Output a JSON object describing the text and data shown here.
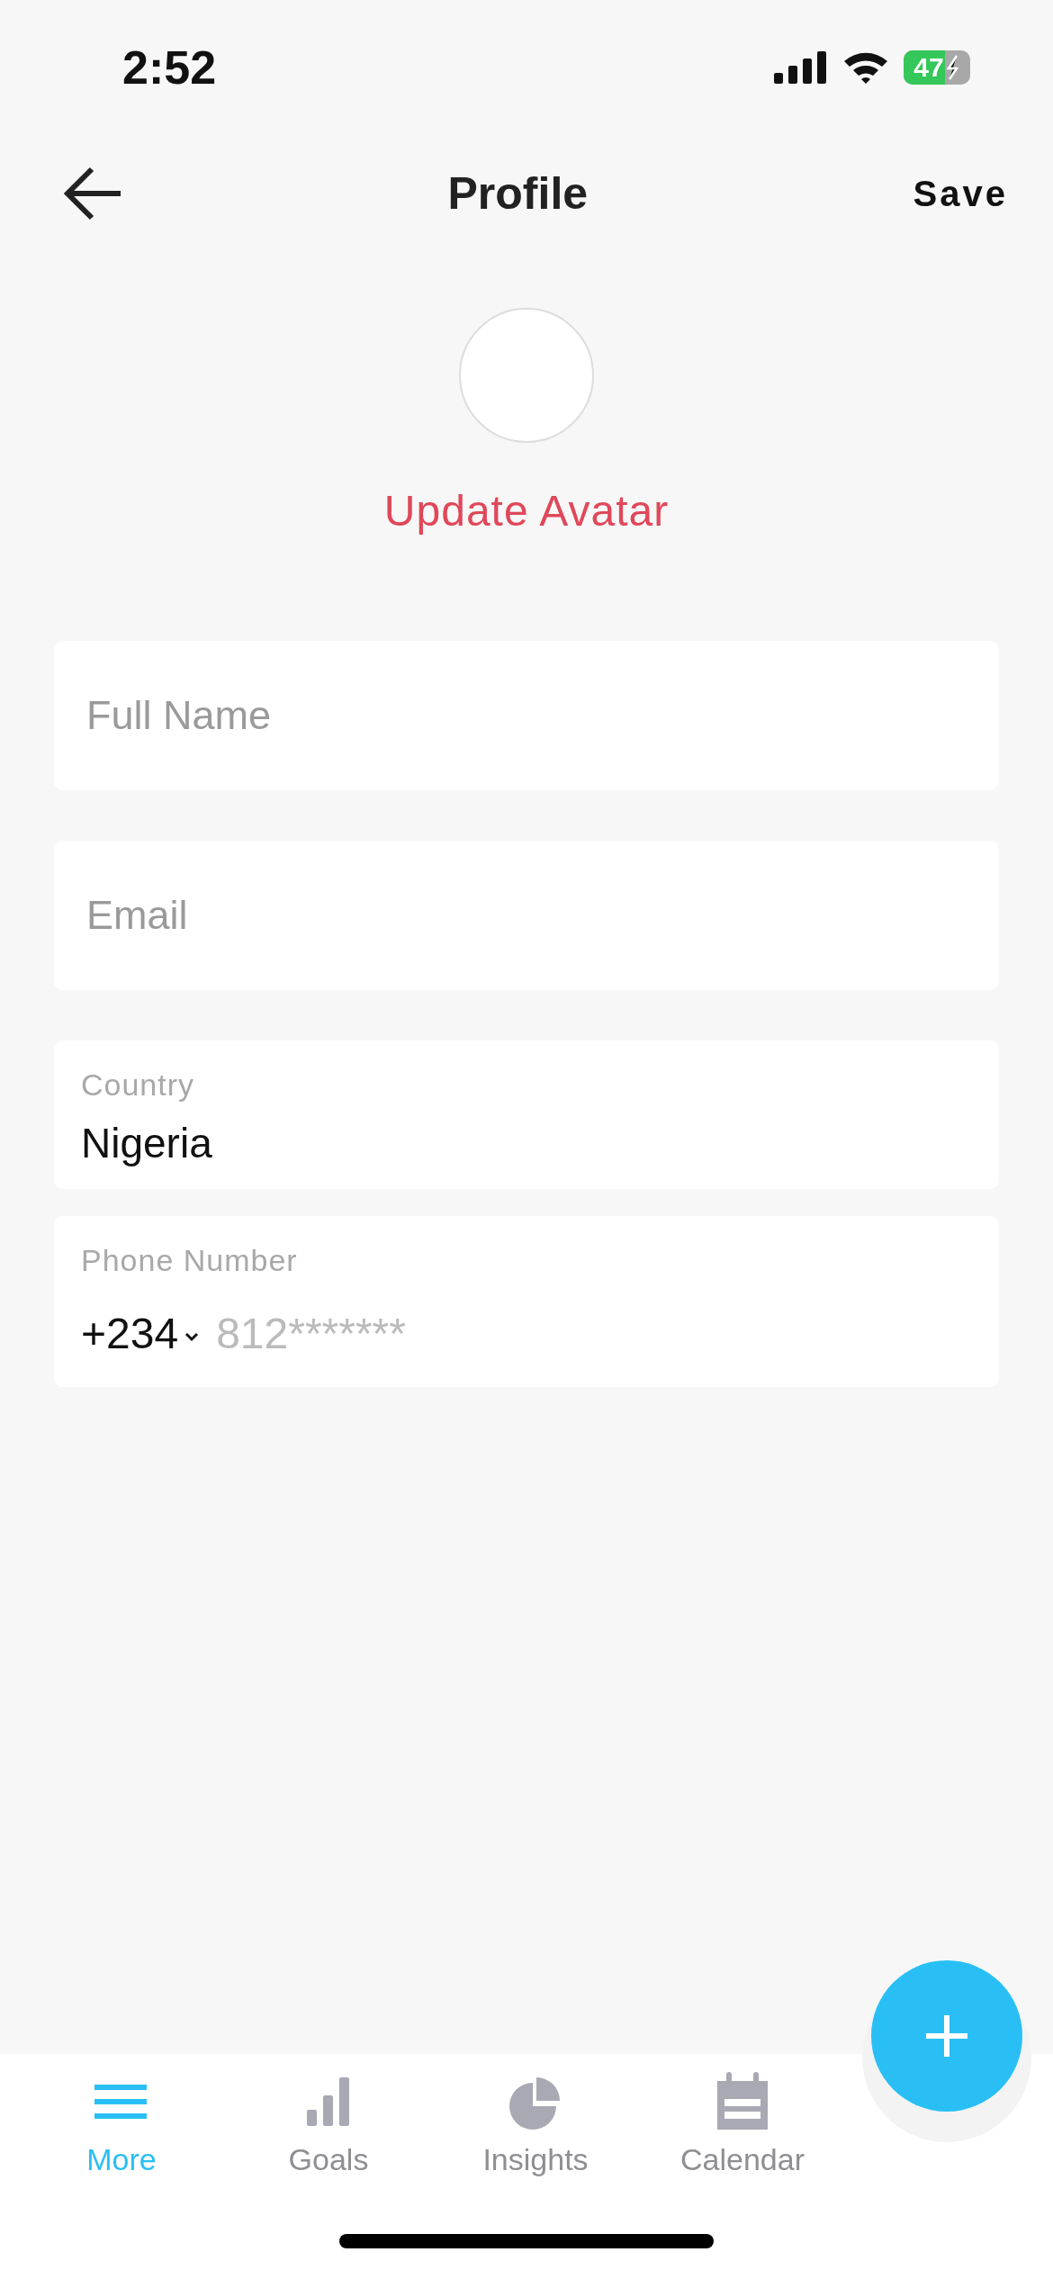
{
  "status_bar": {
    "time": "2:52",
    "battery": "47"
  },
  "header": {
    "title": "Profile",
    "action": "Save"
  },
  "avatar": {
    "action": "Update Avatar"
  },
  "fields": [
    {
      "kind": "plain",
      "placeholder": "Full Name"
    },
    {
      "kind": "plain",
      "placeholder": "Email"
    },
    {
      "kind": "labeled",
      "label": "Country",
      "value": "Nigeria"
    },
    {
      "kind": "phone",
      "label": "Phone Number",
      "code": "+234",
      "placeholder": "812*******"
    }
  ],
  "tabs": [
    {
      "kind": "menu",
      "label": "More",
      "selected": true
    },
    {
      "kind": "bars",
      "label": "Goals",
      "selected": false
    },
    {
      "kind": "pie",
      "label": "Insights",
      "selected": false
    },
    {
      "kind": "calendar",
      "label": "Calendar",
      "selected": false
    }
  ]
}
